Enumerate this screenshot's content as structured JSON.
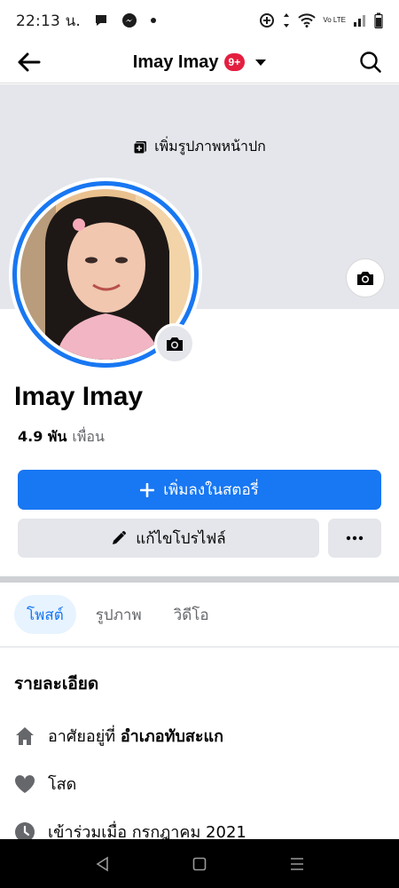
{
  "status_bar": {
    "time": "22:13 น.",
    "network_label": "Vo LTE"
  },
  "header": {
    "title": "Imay Imay",
    "badge": "9+"
  },
  "cover": {
    "add_cover_label": "เพิ่มรูปภาพหน้าปก"
  },
  "profile": {
    "name": "Imay Imay",
    "friends_count": "4.9 พัน",
    "friends_label": "เพื่อน"
  },
  "actions": {
    "add_story_label": "เพิ่มลงในสตอรี่",
    "edit_profile_label": "แก้ไขโปรไฟล์",
    "more_label": "···"
  },
  "tabs": [
    {
      "label": "โพสต์",
      "active": true
    },
    {
      "label": "รูปภาพ",
      "active": false
    },
    {
      "label": "วิดีโอ",
      "active": false
    }
  ],
  "details": {
    "title": "รายละเอียด",
    "lives_in_prefix": "อาศัยอยู่ที่",
    "lives_in_place": "อำเภอทับสะแก",
    "relationship": "โสด",
    "joined": "เข้าร่วมเมื่อ กรกฎาคม 2021"
  },
  "colors": {
    "accent": "#1877f2",
    "badge": "#e41e3f",
    "cover": "#e4e6eb"
  }
}
